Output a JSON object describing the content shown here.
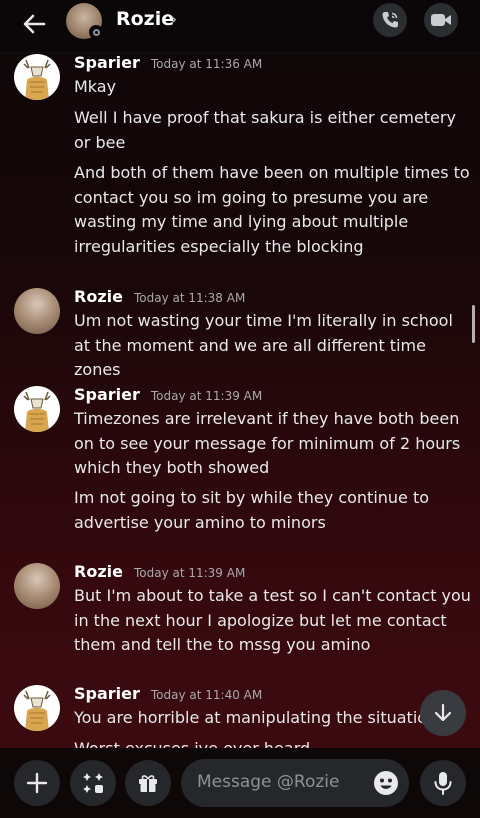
{
  "header": {
    "name": "Rozie",
    "chevron": "›"
  },
  "messages": [
    {
      "author": "Sparier",
      "time": "Today at 11:36 AM",
      "avatar": "deer-skull-avatar",
      "lines": [
        "Mkay",
        "Well I have proof that sakura is either cemetery or bee",
        "And both of them have been on multiple times to contact you so im going to presume you are wasting my time and lying about multiple irregularities especially the blocking"
      ]
    },
    {
      "author": "Rozie",
      "time": "Today at 11:38 AM",
      "avatar": "portrait-avatar",
      "lines": [
        "Um not wasting your time I'm literally in school at the moment and we are all different time zones"
      ]
    },
    {
      "author": "Sparier",
      "time": "Today at 11:39 AM",
      "avatar": "deer-skull-avatar",
      "lines": [
        "Timezones are irrelevant if they have both been on to see your message for minimum of 2 hours which they both showed",
        "Im not going to sit by while they continue to advertise your amino to minors"
      ]
    },
    {
      "author": "Rozie",
      "time": "Today at 11:39 AM",
      "avatar": "portrait-avatar",
      "lines": [
        "But I'm about to take a test so I can't contact you in the next hour I apologize but let me contact them and tell the to mssg you amino"
      ]
    },
    {
      "author": "Sparier",
      "time": "Today at 11:40 AM",
      "avatar": "deer-skull-avatar",
      "lines": [
        "You are horrible at manipulating the situation",
        "Worst excuses ive ever heard"
      ]
    }
  ],
  "composer": {
    "placeholder": "Message @Rozie"
  },
  "colors": {
    "background_top": "#0c0607",
    "background_bottom": "#3d0b10",
    "button_bg": "#26272b"
  },
  "icons": [
    "back-arrow-icon",
    "phone-icon",
    "video-icon",
    "plus-icon",
    "apps-icon",
    "gift-icon",
    "emoji-icon",
    "microphone-icon",
    "arrow-down-icon"
  ]
}
